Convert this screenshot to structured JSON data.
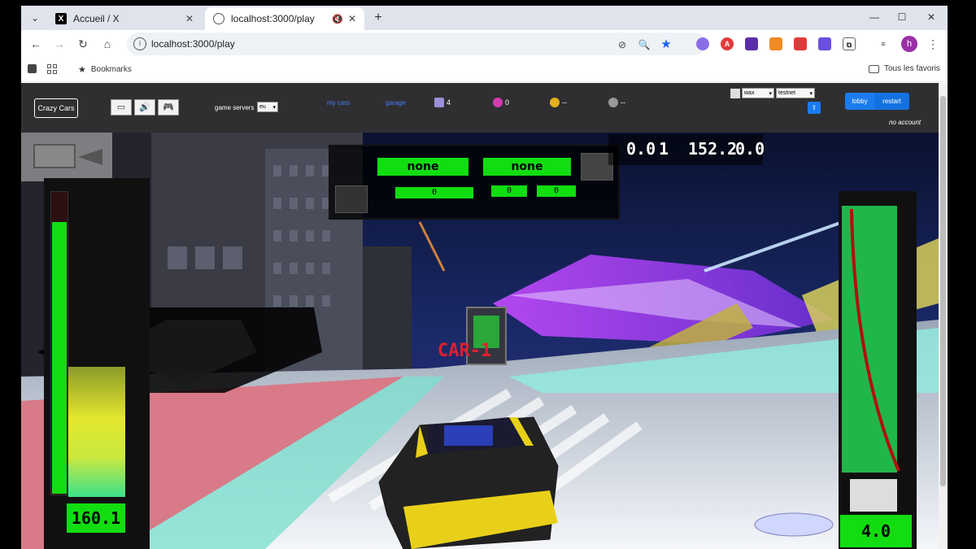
{
  "browser": {
    "tabs": [
      {
        "title": "Accueil / X",
        "favicon": "x-logo-icon"
      },
      {
        "title": "localhost:3000/play",
        "favicon": "globe-icon",
        "muted": true
      }
    ],
    "url": "localhost:3000/play",
    "bookmarks_label": "Bookmarks",
    "all_bookmarks_label": "Tous les favoris",
    "profile_initial": "h"
  },
  "header": {
    "logo_label": "Crazy Cars",
    "game_servers_label": "game servers",
    "server_value": "eu",
    "links": {
      "my_cars": "my cars",
      "garage": "garage"
    },
    "stats": {
      "rockets": "4",
      "gears": "0",
      "coins": "--",
      "tokens": "--"
    },
    "chain_value": "wax",
    "network_value": "testnet",
    "lobby_label": "lobby",
    "restart_label": "restart",
    "account_status": "no account"
  },
  "hud": {
    "slot_a_label": "none",
    "slot_b_label": "none",
    "counter_a": "0",
    "counter_b": "0",
    "counter_c": "0",
    "score_a": "0.0",
    "score_b": "1",
    "score_c": "152.2",
    "score_d": "0.0",
    "speed": "160.1",
    "boost": "4.0",
    "track_sign": "CAR-1",
    "speed_level": 0.9,
    "boost_level": 0.95
  },
  "colors": {
    "hud_green": "#11dd11",
    "header_bg": "#2f2f31",
    "button_blue": "#1b7cf0",
    "link_blue": "#4a7bff"
  }
}
